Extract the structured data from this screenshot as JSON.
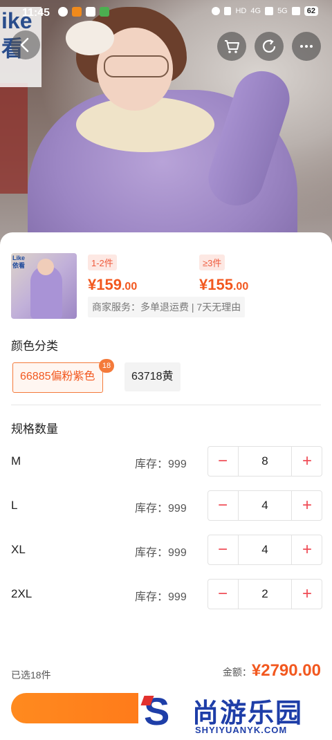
{
  "status_bar": {
    "time": "11:45",
    "battery": "62",
    "net1": "HD",
    "net2": "4G",
    "net3": "5G"
  },
  "watermark_left": {
    "line1": "ike",
    "line2": "看"
  },
  "thumbnail": {
    "brand_top": "Like",
    "brand_bottom": "依看"
  },
  "price_tiers": [
    {
      "range": "1-2件",
      "currency": "¥",
      "integer": "159",
      "cents": ".00"
    },
    {
      "range": "≥3件",
      "currency": "¥",
      "integer": "155",
      "cents": ".00"
    }
  ],
  "services": "商家服务：多单退运费 | 7天无理由",
  "color_section": {
    "title": "颜色分类",
    "options": [
      {
        "label": "66885偏粉紫色",
        "badge": "18",
        "selected": true
      },
      {
        "label": "63718黄",
        "selected": false
      }
    ]
  },
  "spec_section": {
    "title": "规格数量",
    "stock_label": "库存：",
    "rows": [
      {
        "size": "M",
        "stock": "999",
        "qty": "8"
      },
      {
        "size": "L",
        "stock": "999",
        "qty": "4"
      },
      {
        "size": "XL",
        "stock": "999",
        "qty": "4"
      },
      {
        "size": "2XL",
        "stock": "999",
        "qty": "2"
      }
    ],
    "minus": "−",
    "plus": "+"
  },
  "footer": {
    "selected_count": "已选18件",
    "amount_label": "金额：",
    "amount_value": "¥2790.00"
  },
  "watermark_right": {
    "logo": "S",
    "cn": "尚游乐园",
    "en": "SHYIYUANYK.COM"
  },
  "colors": {
    "accent": "#f2581f",
    "stepper_red": "#ef4b55",
    "tag_bg": "#fde8e3"
  },
  "icons": [
    "back-icon",
    "cart-icon",
    "refresh-icon",
    "more-icon",
    "minus-icon",
    "plus-icon"
  ]
}
